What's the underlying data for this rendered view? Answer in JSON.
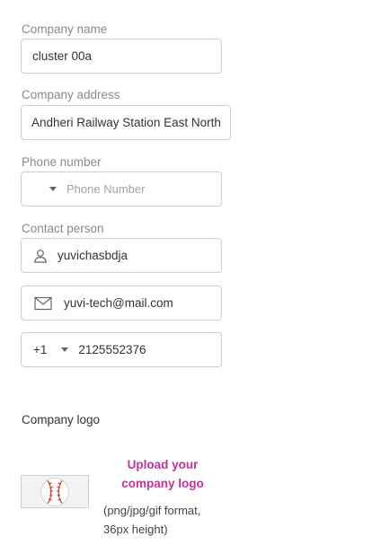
{
  "company_name": {
    "label": "Company name",
    "value": "cluster 00a"
  },
  "company_address": {
    "label": "Company address",
    "value": "Andheri Railway Station East North"
  },
  "phone": {
    "label": "Phone number",
    "placeholder": "Phone Number",
    "icon": "caret-down-icon"
  },
  "contact": {
    "label": "Contact person",
    "name": {
      "value": "yuvichasbdja",
      "icon": "user-icon"
    },
    "email": {
      "value": "yuvi-tech@mail.com",
      "icon": "mail-icon"
    },
    "phone": {
      "country_code": "+1",
      "value": "2125552376",
      "icon": "caret-down-icon"
    }
  },
  "logo": {
    "title": "Company logo",
    "upload_link": "Upload your company logo",
    "hint": "(png/jpg/gif format, 36px height)",
    "accent_color": "#c0339e",
    "image_icon": "baseball-icon"
  }
}
